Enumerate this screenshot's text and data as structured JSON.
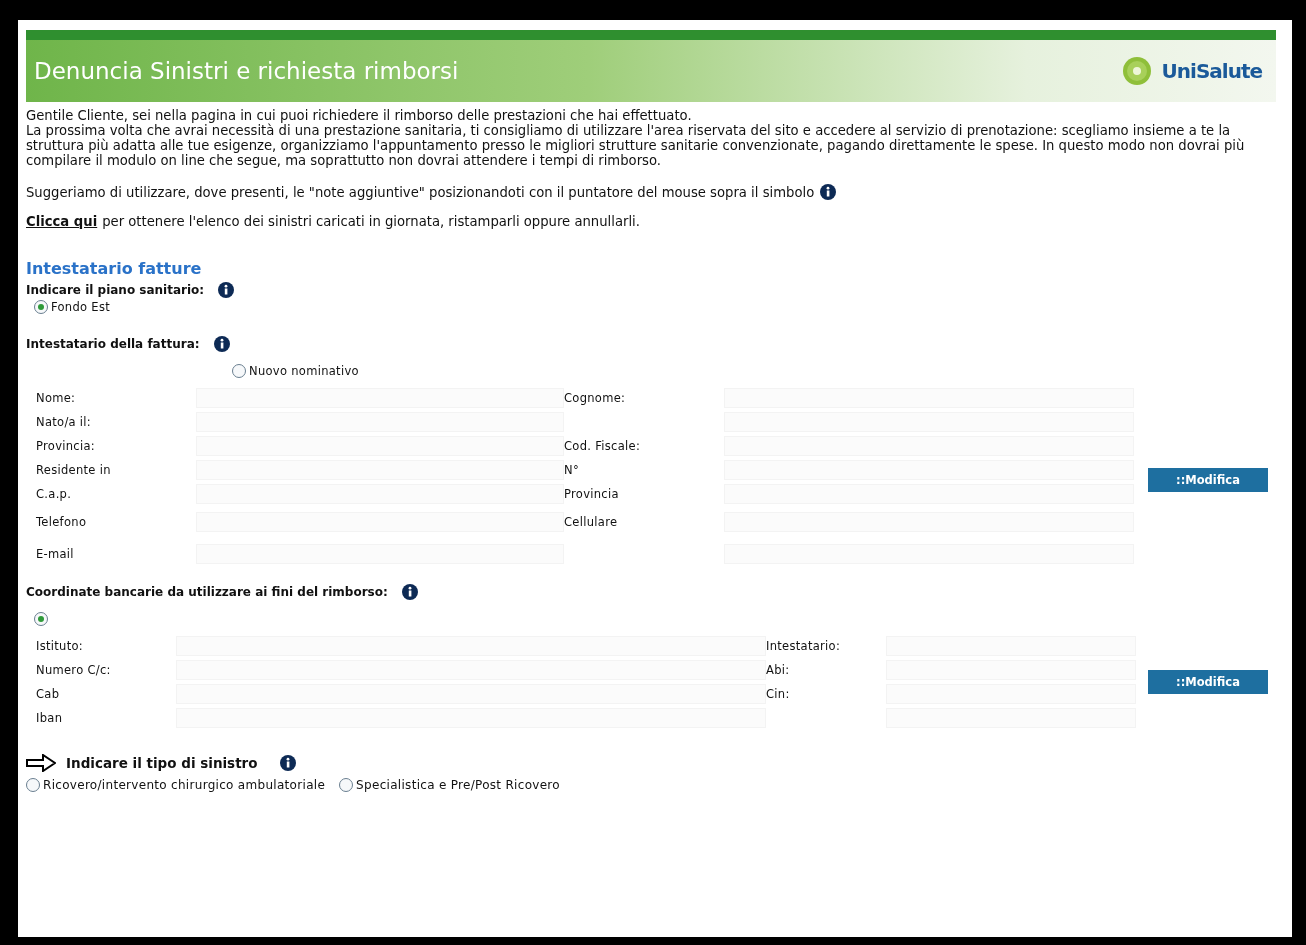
{
  "header": {
    "title": "Denuncia Sinistri e richiesta rimborsi",
    "logo_text": "UniSalute"
  },
  "intro": [
    "Gentile Cliente, sei nella pagina in cui puoi richiedere il rimborso delle prestazioni che hai effettuato.",
    "La prossima volta che avrai necessità di una prestazione sanitaria, ti consigliamo di utilizzare l'area riservata del sito e accedere al servizio di prenotazione: scegliamo insieme a te la struttura più adatta alle tue esigenze, organizziamo l'appuntamento presso le migliori strutture sanitarie convenzionate, pagando direttamente le spese. In questo modo non dovrai più compilare il modulo on line che segue, ma soprattutto non dovrai attendere i tempi di rimborso."
  ],
  "note": "Suggeriamo di utilizzare, dove presenti, le \"note aggiuntive\" posizionandoti con il puntatore del mouse sopra il simbolo",
  "link_line": {
    "link": "Clicca qui",
    "text": "per ottenere l'elenco dei sinistri caricati in giornata, ristamparli oppure annullarli."
  },
  "section_title": "Intestatario fatture",
  "piano": {
    "label": "Indicare il piano sanitario:",
    "options": [
      {
        "label": "Fondo Est",
        "selected": true
      }
    ]
  },
  "intestatario": {
    "label": "Intestatario della fattura:",
    "options": [
      {
        "label": "Nuovo nominativo",
        "selected": false
      }
    ],
    "rows": [
      {
        "left": "Nome:",
        "right": "Cognome:"
      },
      {
        "left": "Nato/a il:"
      },
      {
        "left": "Provincia:",
        "right": "Cod. Fiscale:"
      },
      {
        "left": "Residente in",
        "right": "N°"
      },
      {
        "left": "C.a.p.",
        "right": "Provincia"
      },
      {
        "left": "Telefono",
        "right": "Cellulare"
      },
      {
        "left": "E-mail"
      }
    ],
    "button": "::Modifica"
  },
  "banca": {
    "label": "Coordinate bancarie da utilizzare ai fini del rimborso:",
    "options": [
      {
        "selected": true
      }
    ],
    "rows": [
      {
        "left": "Istituto:",
        "right": "Intestatario:"
      },
      {
        "left": "Numero C/c:",
        "right": "Abi:"
      },
      {
        "left": "Cab",
        "right": "Cin:"
      },
      {
        "left": "Iban"
      }
    ],
    "button": "::Modifica"
  },
  "tipo": {
    "label": "Indicare il tipo di sinistro",
    "options": [
      {
        "label": "Ricovero/intervento chirurgico ambulatoriale",
        "selected": false
      },
      {
        "label": "Specialistica e Pre/Post Ricovero",
        "selected": false
      }
    ]
  }
}
